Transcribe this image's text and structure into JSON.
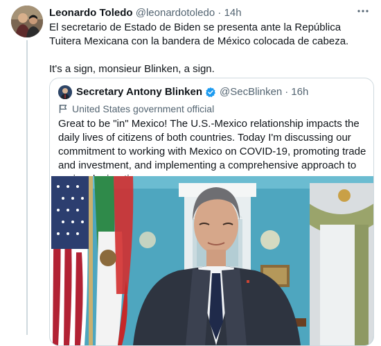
{
  "tweet": {
    "author_name": "Leonardo Toledo",
    "author_handle": "@leonardotoledo",
    "separator": "·",
    "time": "14h",
    "text": "El secretario de Estado de Biden se presenta ante la República Tuitera Mexicana con la bandera de México colocada de cabeza.\n\nIt's a sign, monsieur Blinken, a sign."
  },
  "quoted_tweet": {
    "author_name": "Secretary Antony Blinken",
    "author_handle": "@SecBlinken",
    "separator": "·",
    "time": "16h",
    "label": "United States government official",
    "text": "Great to be \"in\" Mexico! The U.S.-Mexico relationship impacts the daily lives of citizens of both countries. Today I'm discussing our commitment to working with Mexico on COVID-19, promoting trade and investment, and implementing a comprehensive approach to regional migration."
  },
  "colors": {
    "accent": "#1d9bf0",
    "secondary_text": "#536471",
    "border": "#cfd9de",
    "wall": "#4ea6bf"
  },
  "icons": {
    "more": "more-horizontal-icon",
    "verified": "verified-badge-icon",
    "label": "flag-icon"
  }
}
